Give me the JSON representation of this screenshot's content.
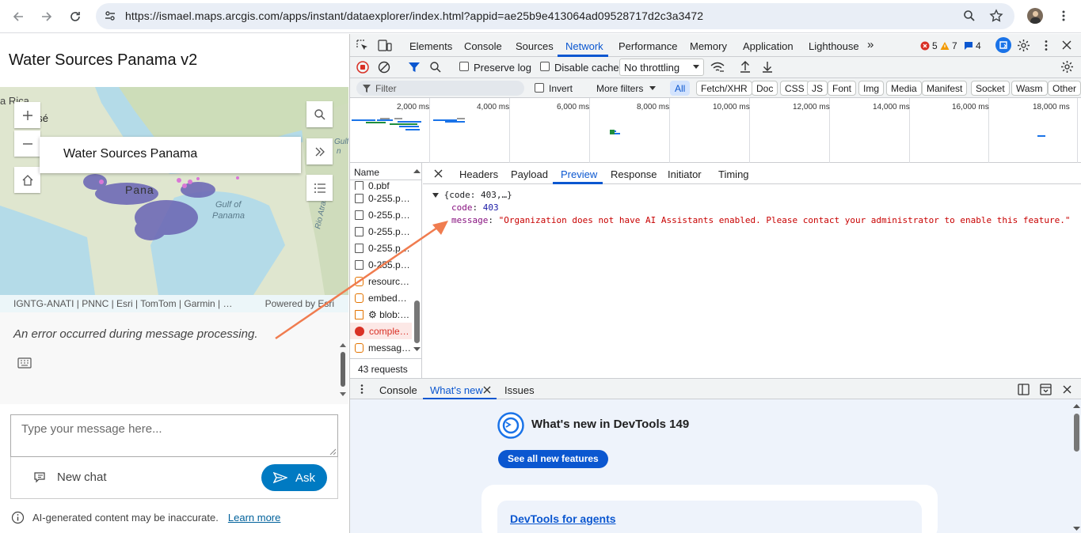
{
  "browser": {
    "url": "https://ismael.maps.arcgis.com/apps/instant/dataexplorer/index.html?appid=ae25b9e413064ad09528717d2c3a3472",
    "nav_icons": [
      "back-icon",
      "forward-icon",
      "reload-icon",
      "site-settings-icon",
      "zoom-icon",
      "star-icon",
      "profile-avatar",
      "menu-icon"
    ]
  },
  "app": {
    "title": "Water Sources Panama v2",
    "map": {
      "labels": {
        "costa_rica": "a Rica",
        "san_jose": "osé",
        "panama": "Pana",
        "gulf": "Gulf of",
        "gulf2": "Panama",
        "gulf_top": "Gulf of",
        "gulf_top2": "n",
        "rio": "Rio Atrato"
      },
      "popup_title": "Water Sources Panama",
      "attribution": "IGNTG-ANATI | PNNC | Esri | TomTom | Garmin | …",
      "powered_by": "Powered by Esri"
    },
    "chat": {
      "error_message": "An error occurred during message processing.",
      "input_placeholder": "Type your message here...",
      "new_chat_label": "New chat",
      "ask_label": "Ask",
      "disclaimer": "AI-generated content may be inaccurate.",
      "learn_more": "Learn more"
    }
  },
  "devtools": {
    "tabs": [
      "Elements",
      "Console",
      "Sources",
      "Network",
      "Performance",
      "Memory",
      "Application",
      "Lighthouse"
    ],
    "active_tab": "Network",
    "more_tabs": "»",
    "errors": "5",
    "warnings": "7",
    "messages": "4",
    "toolbar": {
      "preserve_log": "Preserve log",
      "disable_cache": "Disable cache",
      "throttling": "No throttling"
    },
    "filter": {
      "placeholder": "Filter",
      "invert": "Invert",
      "more_filters": "More filters",
      "types": [
        "All",
        "Fetch/XHR",
        "Doc",
        "CSS",
        "JS",
        "Font",
        "Img",
        "Media",
        "Manifest",
        "Socket",
        "Wasm",
        "Other"
      ]
    },
    "timeline_ticks": [
      "2,000 ms",
      "4,000 ms",
      "6,000 ms",
      "8,000 ms",
      "10,000 ms",
      "12,000 ms",
      "14,000 ms",
      "16,000 ms",
      "18,000 ms"
    ],
    "requests": {
      "header": "Name",
      "rows": [
        {
          "name": "0.pbf",
          "type": "doc"
        },
        {
          "name": "0-255.p…",
          "type": "doc"
        },
        {
          "name": "0-255.p…",
          "type": "doc"
        },
        {
          "name": "0-255.p…",
          "type": "doc"
        },
        {
          "name": "0-255.p…",
          "type": "doc"
        },
        {
          "name": "0-255.p…",
          "type": "doc"
        },
        {
          "name": "resourc…",
          "type": "json"
        },
        {
          "name": "embed…",
          "type": "json"
        },
        {
          "name": "⚙ blob:…",
          "type": "script"
        },
        {
          "name": "comple…",
          "type": "error"
        },
        {
          "name": "messag…",
          "type": "json"
        }
      ],
      "count": "43 requests"
    },
    "detail_tabs": [
      "Headers",
      "Payload",
      "Preview",
      "Response",
      "Initiator",
      "Timing"
    ],
    "active_detail_tab": "Preview",
    "preview": {
      "summary": "{code: 403,…}",
      "code_key": "code",
      "code_value": "403",
      "message_key": "message",
      "message_value": "\"Organization does not have AI Assistants enabled. Please contact your administrator to enable this feature.\""
    },
    "drawer": {
      "tabs": [
        "Console",
        "What's new",
        "Issues"
      ],
      "active": "What's new",
      "whatsnew_title": "What's new in DevTools 149",
      "see_all": "See all new features",
      "card_link": "DevTools for agents"
    }
  },
  "colors": {
    "accent": "#0b57d0",
    "esri_blue": "#007ac2",
    "error": "#d93025",
    "warning": "#f29900",
    "string_red": "#c80000",
    "key_purple": "#881280",
    "annotation_arrow": "#f07c4f"
  }
}
